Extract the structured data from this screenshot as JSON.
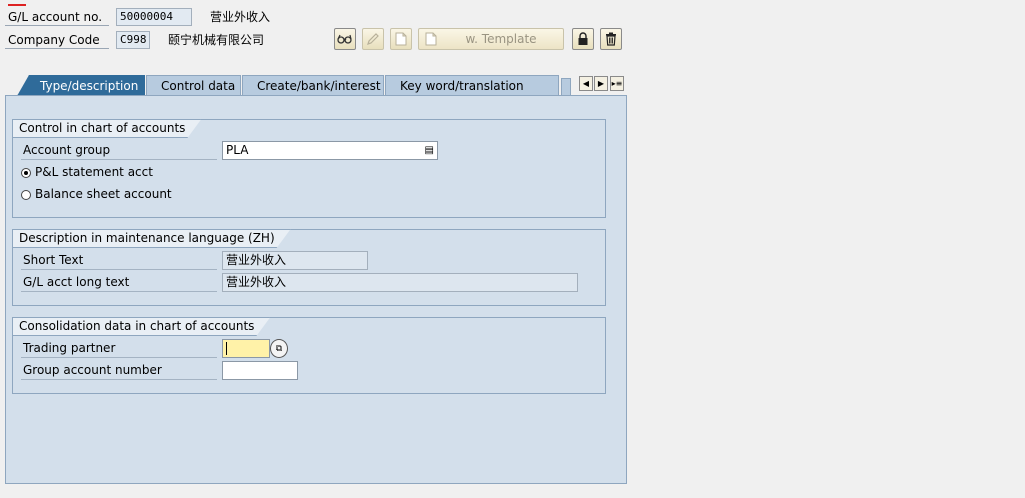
{
  "header": {
    "gl_account_label": "G/L account no.",
    "gl_account_value": "50000004",
    "gl_account_desc": "营业外收入",
    "company_code_label": "Company Code",
    "company_code_value": "C998",
    "company_name": "颐宁机械有限公司"
  },
  "toolbar": {
    "display_change_icon": "glasses-icon",
    "change_icon": "pencil-icon",
    "create_icon": "new-document-icon",
    "template_label": "w. Template",
    "lock_icon": "lock-icon",
    "delete_icon": "trash-icon"
  },
  "tabs": [
    {
      "label": "Type/description",
      "active": true
    },
    {
      "label": "Control data",
      "active": false
    },
    {
      "label": "Create/bank/interest",
      "active": false
    },
    {
      "label": "Key word/translation",
      "active": false
    }
  ],
  "control_group": {
    "title": "Control in chart of accounts",
    "account_group_label": "Account group",
    "account_group_value": "PLA",
    "radio_pl_label": "P&L statement acct",
    "radio_bs_label": "Balance sheet account",
    "selected": "pl"
  },
  "description_group": {
    "title": "Description in maintenance language (ZH)",
    "short_text_label": "Short Text",
    "short_text_value": "营业外收入",
    "long_text_label": "G/L acct long text",
    "long_text_value": "营业外收入"
  },
  "consolidation_group": {
    "title": "Consolidation data in chart of accounts",
    "trading_partner_label": "Trading partner",
    "trading_partner_value": "",
    "group_account_label": "Group account number",
    "group_account_value": ""
  },
  "colors": {
    "active_tab": "#2f6b9a",
    "panel_bg": "#d3dfeb",
    "required_field": "#fff2a8"
  }
}
